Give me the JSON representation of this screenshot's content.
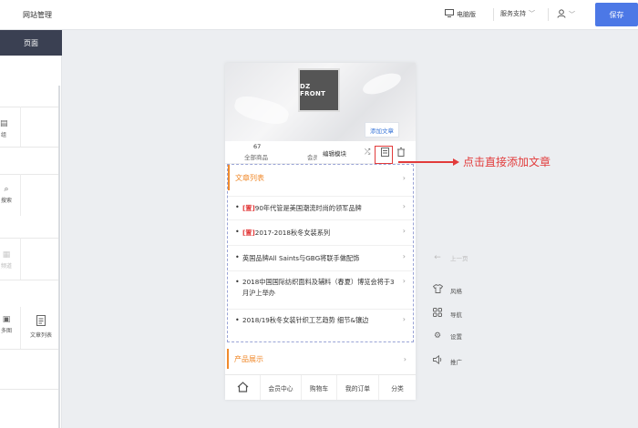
{
  "topbar": {
    "site_title": "网站管理",
    "pc_label": "电脑版",
    "service_label": "服务支持",
    "save_label": "保存"
  },
  "left": {
    "active_tab": "页面",
    "cells": [
      {
        "label": "组"
      },
      {
        "label": "搜索"
      },
      {
        "label": "频道"
      },
      {
        "label": "多图"
      },
      {
        "label": "文章列表"
      }
    ]
  },
  "phone": {
    "logo_text": "DZ FRONT",
    "add_article_tip": "添加文章",
    "stats": {
      "count": "67",
      "count_label": "全部商品",
      "label2": "会员"
    },
    "module_toolbar": {
      "edit_label": "编辑模块"
    },
    "article_list": {
      "title": "文章列表",
      "items": [
        {
          "tag": "[置]",
          "text": "90年代管是美国潮流时尚的领军品牌"
        },
        {
          "tag": "[置]",
          "text": "2017-2018秋冬女装系列"
        },
        {
          "tag": "",
          "text": "英国品牌All Saints与GBG将联手做配饰"
        },
        {
          "tag": "",
          "text": "2018中国国际纺织面料及辅料（春夏）博览会将于3月沪上举办"
        },
        {
          "tag": "",
          "text": "2018/19秋冬女装针织工艺趋势 细节&镶边"
        }
      ]
    },
    "products_title": "产品展示",
    "bottom_nav": [
      "会员中心",
      "购物车",
      "我的订单",
      "分类"
    ]
  },
  "annotation": {
    "text": "点击直接添加文章",
    "color": "#e23b3b"
  },
  "right_tools": [
    {
      "icon": "arrow-left-icon",
      "label": "上一页"
    },
    {
      "icon": "shirt-icon",
      "label": "风格"
    },
    {
      "icon": "grid-icon",
      "label": "导航"
    },
    {
      "icon": "gear-icon",
      "label": "设置"
    },
    {
      "icon": "speaker-icon",
      "label": "推广"
    }
  ],
  "colors": {
    "accent": "#4c78e6",
    "orange": "#f08a2c",
    "highlight": "#e23b3b"
  }
}
